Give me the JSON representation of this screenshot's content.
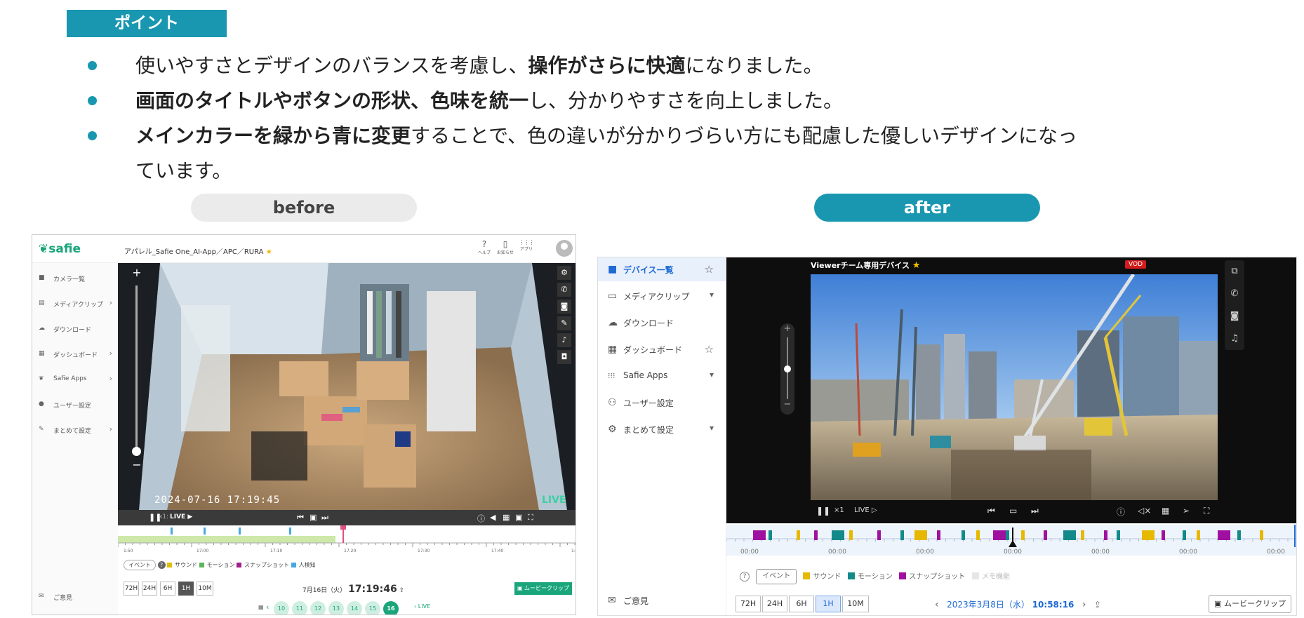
{
  "header": {
    "point_label": "ポイント",
    "bullets": [
      {
        "pre": "使いやすさとデザインのバランスを考慮し、",
        "bold": "操作がさらに快適",
        "post": "になりました。"
      },
      {
        "pre": "",
        "bold": "画面のタイトルやボタンの形状、色味を統一",
        "post": "し、分かりやすさを向上しました。"
      },
      {
        "pre": "",
        "bold": "メインカラーを緑から青に変更",
        "post": "することで、色の違いが分かりづらい方にも配慮した優しいデザインになっ"
      }
    ],
    "bullet3_line2": "ています。",
    "before_label": "before",
    "after_label": "after",
    "colors": {
      "accent": "#1a97b0",
      "before_pill": "#ebebeb"
    }
  },
  "before": {
    "logo": "safie",
    "breadcrumb": "アパレル_Safie One_AI-App／APC／RURA",
    "top_icons": [
      {
        "icon": "help-icon",
        "glyph": "?",
        "label": "ヘルプ"
      },
      {
        "icon": "notice-icon",
        "glyph": "▯",
        "label": "お知らせ"
      },
      {
        "icon": "apps-icon",
        "glyph": "⋮⋮⋮",
        "label": "アプリ"
      }
    ],
    "sidebar": [
      {
        "label": "カメラ一覧",
        "icon": "camera-icon",
        "glyph": "■",
        "arrow": ""
      },
      {
        "label": "メディアクリップ",
        "icon": "clip-icon",
        "glyph": "▤",
        "arrow": "›"
      },
      {
        "label": "ダウンロード",
        "icon": "download-icon",
        "glyph": "☁",
        "arrow": ""
      },
      {
        "label": "ダッシュボード",
        "icon": "dashboard-icon",
        "glyph": "▦",
        "arrow": "›"
      },
      {
        "label": "Safie Apps",
        "icon": "apps-icon",
        "glyph": "❦",
        "arrow": "›"
      },
      {
        "label": "ユーザー設定",
        "icon": "user-icon",
        "glyph": "●",
        "arrow": ""
      },
      {
        "label": "まとめて設定",
        "icon": "wrench-icon",
        "glyph": "✎",
        "arrow": "›"
      }
    ],
    "feedback": "ご意見",
    "camera_timestamp": "2024-07-16 17:19:45",
    "live_badge": "LIVE",
    "speed": "x1:",
    "live_btn": "LIVE ▶",
    "timeline_ticks": [
      "17:00",
      "17:10",
      "17:20",
      "17:30",
      "17:40",
      "1:"
    ],
    "timeline_first_tick": "1:50",
    "legend_event": "イベント",
    "legend": [
      {
        "label": "サウンド",
        "color": "#e0c000"
      },
      {
        "label": "モーション",
        "color": "#5bb55b"
      },
      {
        "label": "スナップショット",
        "color": "#a0208c"
      },
      {
        "label": "人検知",
        "color": "#45a8e0"
      }
    ],
    "range_buttons": [
      "72H",
      "24H",
      "6H",
      "1H",
      "10M"
    ],
    "range_selected": "1H",
    "date": "7月16日（火）",
    "time": "17:19:46",
    "movie_clip": "ムービークリップ",
    "hours": [
      "10",
      "11",
      "12",
      "13",
      "14",
      "15",
      "16"
    ],
    "hour_selected": "16",
    "live_link": "LIVE",
    "colors": {
      "main": "#1aa67a",
      "timeline_green": "#cde8a8"
    }
  },
  "after": {
    "sidebar": [
      {
        "label": "デバイス一覧",
        "icon": "device-icon",
        "glyph": "■",
        "arrow": "☆",
        "active": true
      },
      {
        "label": "メディアクリップ",
        "icon": "clip-icon",
        "glyph": "▭",
        "arrow": "▾",
        "active": false
      },
      {
        "label": "ダウンロード",
        "icon": "download-icon",
        "glyph": "☁",
        "arrow": "",
        "active": false
      },
      {
        "label": "ダッシュボード",
        "icon": "dashboard-icon",
        "glyph": "▦",
        "arrow": "☆",
        "active": false
      },
      {
        "label": "Safie Apps",
        "icon": "apps-icon",
        "glyph": "⁝⁝⁝",
        "arrow": "▾",
        "active": false
      },
      {
        "label": "ユーザー設定",
        "icon": "user-settings-icon",
        "glyph": "⚇",
        "arrow": "",
        "active": false
      },
      {
        "label": "まとめて設定",
        "icon": "gear-icon",
        "glyph": "⚙",
        "arrow": "▾",
        "active": false
      }
    ],
    "feedback": "ご意見",
    "device_title": "Viewerチーム専用デバイス",
    "vod_badge": "VOD",
    "speed": "×1",
    "live_btn": "LIVE ▷",
    "timeline_ticks": [
      "00:00",
      "00:00",
      "00:00",
      "00:00",
      "00:00",
      "00:00",
      "00:00"
    ],
    "legend_event": "イベント",
    "legend": [
      {
        "label": "サウンド",
        "color": "#e6b800"
      },
      {
        "label": "モーション",
        "color": "#138a8a"
      },
      {
        "label": "スナップショット",
        "color": "#a010a0"
      },
      {
        "label": "メモ機能",
        "color": "#dddddd"
      }
    ],
    "range_buttons": [
      "72H",
      "24H",
      "6H",
      "1H",
      "10M"
    ],
    "range_selected": "1H",
    "date": "2023年3月8日（水）",
    "time": "10:58:16",
    "movie_clip": "ムービークリップ",
    "colors": {
      "main": "#1e6ad4",
      "selected_bg": "#dbe8fb"
    }
  }
}
